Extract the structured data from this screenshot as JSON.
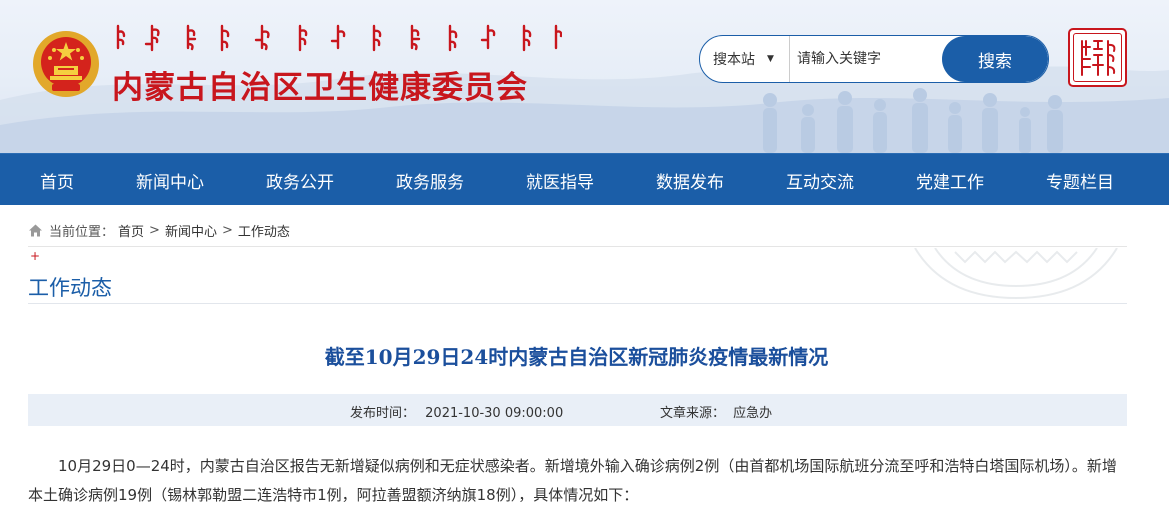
{
  "header": {
    "site_title": "内蒙古自治区卫生健康委员会",
    "search": {
      "scope_label": "搜本站",
      "placeholder": "请输入关键字",
      "button_label": "搜索"
    }
  },
  "nav": {
    "items": [
      {
        "label": "首页"
      },
      {
        "label": "新闻中心"
      },
      {
        "label": "政务公开"
      },
      {
        "label": "政务服务"
      },
      {
        "label": "就医指导"
      },
      {
        "label": "数据发布"
      },
      {
        "label": "互动交流"
      },
      {
        "label": "党建工作"
      },
      {
        "label": "专题栏目"
      }
    ]
  },
  "breadcrumb": {
    "label": "当前位置：",
    "items": [
      "首页",
      "新闻中心",
      "工作动态"
    ],
    "separator": ">"
  },
  "section": {
    "title": "工作动态"
  },
  "article": {
    "title": "截至10月29日24时内蒙古自治区新冠肺炎疫情最新情况",
    "publish_label": "发布时间：",
    "publish_time": "2021-10-30 09:00:00",
    "source_label": "文章来源：",
    "source": "应急办",
    "body": "10月29日0—24时，内蒙古自治区报告无新增疑似病例和无症状感染者。新增境外输入确诊病例2例（由首都机场国际航班分流至呼和浩特白塔国际机场）。新增本土确诊病例19例（锡林郭勒盟二连浩特市1例，阿拉善盟额济纳旗18例），具体情况如下："
  },
  "colors": {
    "brand_blue": "#1b5ea8",
    "title_red": "#c8161d",
    "article_title_blue": "#1b4f9c",
    "meta_bg": "#e9eff7"
  }
}
